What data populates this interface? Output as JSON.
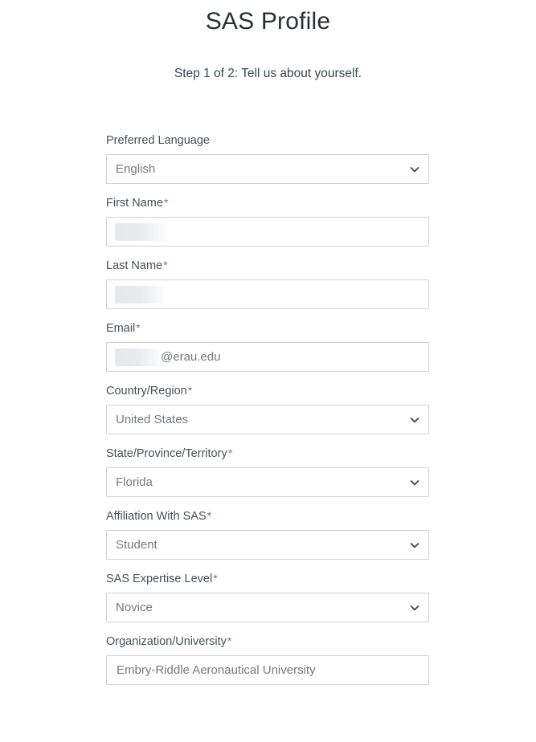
{
  "header": {
    "title": "SAS Profile",
    "subtitle": "Step 1 of 2: Tell us about yourself."
  },
  "form": {
    "required_marker": "*",
    "fields": [
      {
        "id": "preferred-language",
        "label": "Preferred Language",
        "required": false,
        "type": "select",
        "value": "English"
      },
      {
        "id": "first-name",
        "label": "First Name",
        "required": true,
        "type": "text",
        "value": "",
        "redacted": true
      },
      {
        "id": "last-name",
        "label": "Last Name",
        "required": true,
        "type": "text",
        "value": "",
        "redacted": true
      },
      {
        "id": "email",
        "label": "Email",
        "required": true,
        "type": "text",
        "value": "@erau.edu",
        "redacted": true
      },
      {
        "id": "country-region",
        "label": "Country/Region",
        "required": true,
        "type": "select",
        "value": "United States"
      },
      {
        "id": "state-province-territory",
        "label": "State/Province/Territory",
        "required": true,
        "type": "select",
        "value": "Florida"
      },
      {
        "id": "affiliation-with-sas",
        "label": "Affiliation With SAS",
        "required": true,
        "type": "select",
        "value": "Student"
      },
      {
        "id": "sas-expertise-level",
        "label": "SAS Expertise Level",
        "required": true,
        "type": "select",
        "value": "Novice"
      },
      {
        "id": "organization-university",
        "label": "Organization/University",
        "required": true,
        "type": "text",
        "value": "Embry-Riddle Aeronautical University"
      }
    ]
  },
  "colors": {
    "title_text": "#2b2f33",
    "label_text": "#4a4f55",
    "value_text": "#77797d",
    "required_asterisk": "#b45a4e",
    "field_border": "#cfd2d4",
    "background": "#ffffff"
  },
  "icons": {
    "chevron_down": "chevron-down-icon"
  }
}
